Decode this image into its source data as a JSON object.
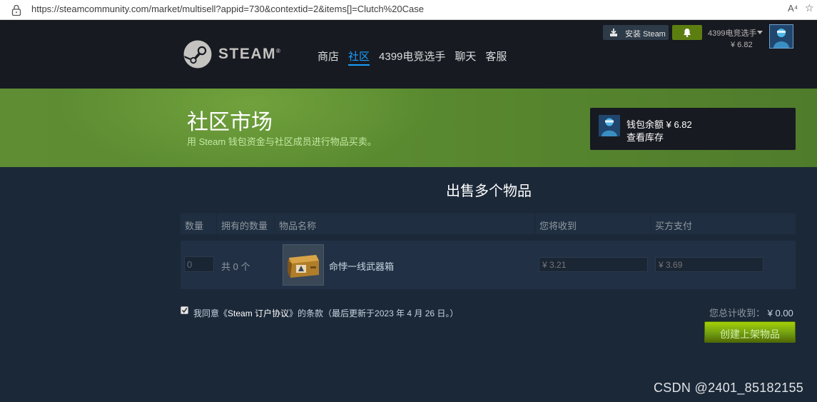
{
  "browser": {
    "url": "https://steamcommunity.com/market/multisell?appid=730&contextid=2&items[]=Clutch%20Case",
    "read_aloud_glyph": "A⁴",
    "star_glyph": "☆"
  },
  "header": {
    "logo_text": "STEAM",
    "logo_tm": "®",
    "nav": [
      "商店",
      "社区",
      "4399电竞选手",
      "聊天",
      "客服"
    ],
    "install_label": "安装 Steam",
    "account_name": "4399电竞选手",
    "account_balance": "¥ 6.82",
    "colors": {
      "nav_active": "#1a9fff",
      "notif_bg": "#5c7e10"
    }
  },
  "banner": {
    "title": "社区市场",
    "subtitle": "用 Steam 钱包资金与社区成员进行物品买卖。",
    "wallet_balance": "钱包余额 ¥ 6.82",
    "view_inventory": "查看库存"
  },
  "main": {
    "heading": "出售多个物品",
    "columns": [
      "数量",
      "拥有的数量",
      "物品名称",
      "您将收到",
      "买方支付"
    ],
    "row": {
      "quantity_value": "0",
      "owned_text": "共 0 个",
      "item_name": "命悖一线武器箱",
      "receive_value": "¥ 3.21",
      "buyer_pays_value": "¥ 3.69"
    },
    "agreement_prefix": "我同意《",
    "agreement_link": "Steam 订户协议",
    "agreement_suffix": "》的条款（最后更新于2023 年 4 月 26 日。）",
    "agreement_checked": true,
    "total_label": "您总计收到：",
    "total_value": "¥ 0.00",
    "create_button": "创建上架物品"
  },
  "watermark": "CSDN @2401_85182155"
}
